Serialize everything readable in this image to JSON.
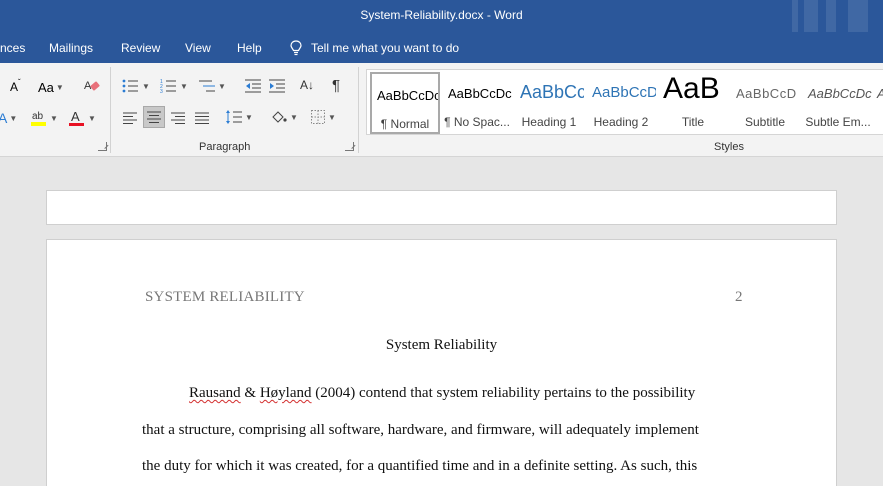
{
  "window": {
    "title": "System-Reliability.docx  -  Word"
  },
  "tabs": [
    "nces",
    "Mailings",
    "Review",
    "View",
    "Help"
  ],
  "tell_me": "Tell me what you want to do",
  "ribbon": {
    "font_size_glyph": "A",
    "change_case": "Aa",
    "paragraph_mark": "¶",
    "sort_glyph": "A↓",
    "paragraph_group": "Paragraph",
    "styles_group": "Styles"
  },
  "styles": [
    {
      "sample": "AaBbCcDc",
      "name": "¶ Normal",
      "selected": true
    },
    {
      "sample": "AaBbCcDc",
      "name": "¶ No Spac..."
    },
    {
      "sample": "AaBbCc",
      "name": "Heading 1"
    },
    {
      "sample": "AaBbCcD",
      "name": "Heading 2"
    },
    {
      "sample": "AaB",
      "name": "Title"
    },
    {
      "sample": "AaBbCcD",
      "name": "Subtitle"
    },
    {
      "sample": "AaBbCcDc",
      "name": "Subtle Em..."
    }
  ],
  "colors": {
    "accent": "#2b579a",
    "highlight": "#ffff00",
    "font_color": "#e81123"
  },
  "document": {
    "running_head": "SYSTEM RELIABILITY",
    "page_number": "2",
    "heading": "System Reliability",
    "line1_a": "Rausand",
    "line1_b": " & ",
    "line1_c": "Høyland",
    "line1_d": " (2004) contend that system reliability pertains to the possibility",
    "line2": "that a structure, comprising all software, hardware, and firmware, will adequately implement",
    "line3": "the duty for which it was created, for a quantified time and in a definite setting. As such, this"
  }
}
